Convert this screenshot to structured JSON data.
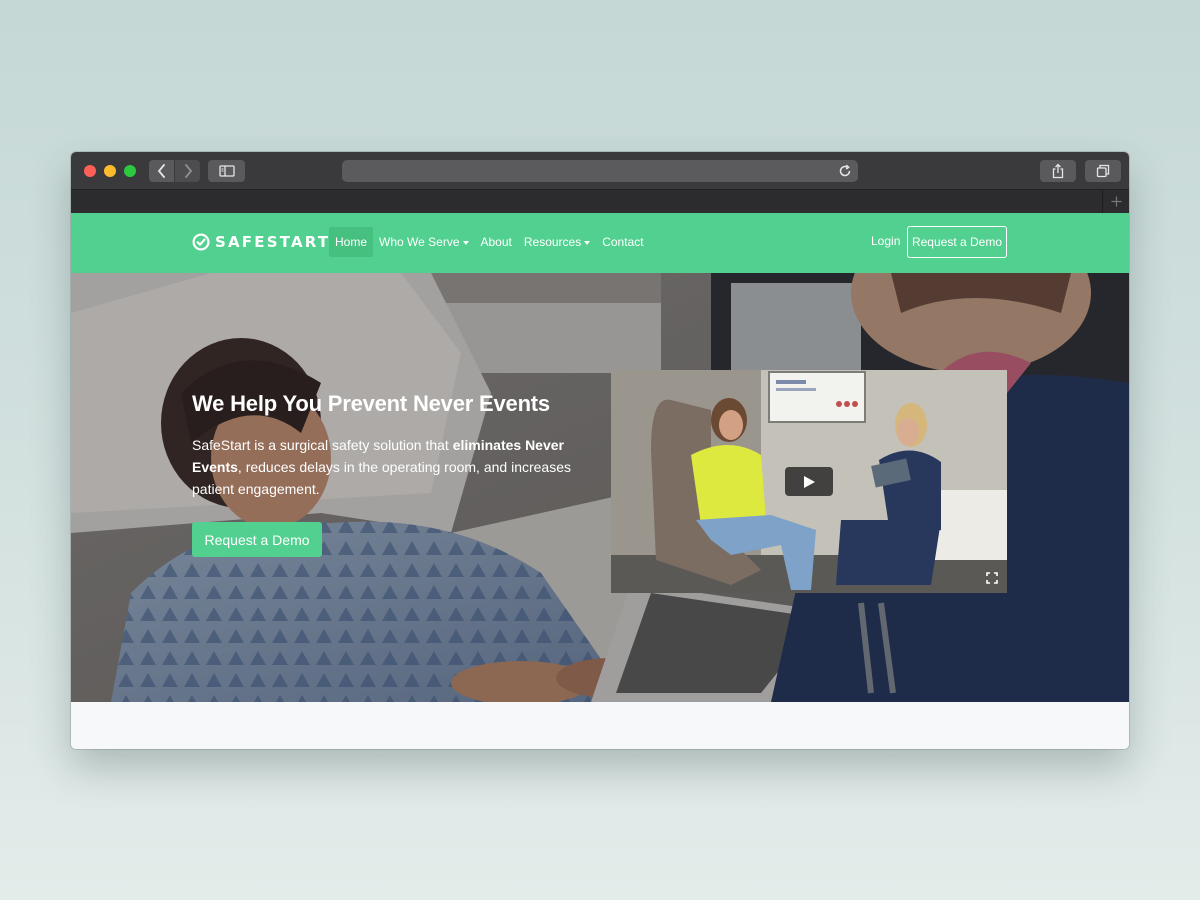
{
  "brand": {
    "name": "SAFESTART",
    "accent_color": "#52d090"
  },
  "browser": {
    "buttons": [
      "back-icon",
      "forward-icon",
      "sidebar-icon",
      "reload-icon",
      "share-icon",
      "tabs-icon",
      "new-tab-icon"
    ],
    "address": ""
  },
  "nav": {
    "items": [
      {
        "label": "Home",
        "active": true
      },
      {
        "label": "Who We Serve",
        "dropdown": true
      },
      {
        "label": "About"
      },
      {
        "label": "Resources",
        "dropdown": true
      },
      {
        "label": "Contact"
      }
    ],
    "login": "Login",
    "cta": "Request a Demo"
  },
  "hero": {
    "title": "We Help You Prevent Never Events",
    "desc_pre": "SafeStart is a surgical safety solution that ",
    "desc_bold": "eliminates Never Events",
    "desc_post": ", reduces delays in the operating room, and increases patient engagement.",
    "cta": "Request a Demo"
  },
  "video": {
    "play_icon": "play-icon",
    "fullscreen_icon": "fullscreen-icon"
  }
}
